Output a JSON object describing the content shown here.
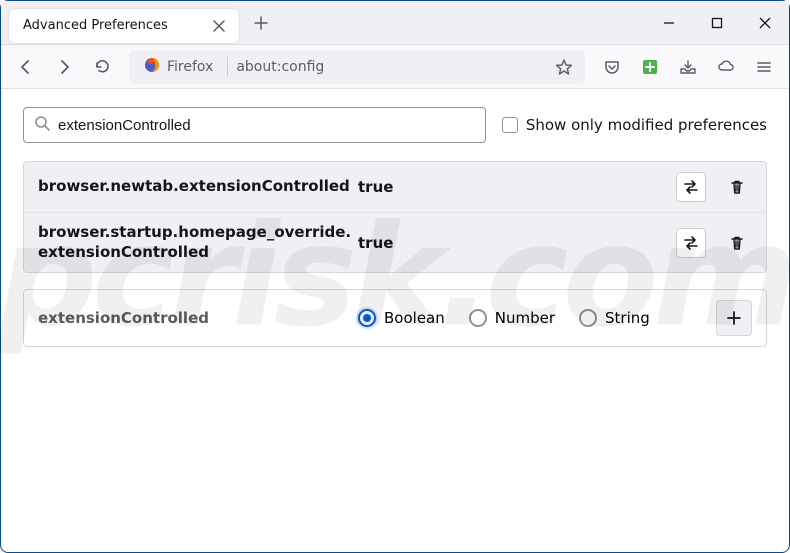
{
  "window": {
    "tab_title": "Advanced Preferences"
  },
  "urlbar": {
    "identity_label": "Firefox",
    "url": "about:config"
  },
  "search": {
    "value": "extensionControlled",
    "modified_only_label": "Show only modified preferences"
  },
  "prefs": [
    {
      "name": "browser.newtab.extensionControlled",
      "value": "true"
    },
    {
      "name": "browser.startup.homepage_override.extensionControlled",
      "value": "true"
    }
  ],
  "new_pref": {
    "name": "extensionControlled",
    "types": [
      "Boolean",
      "Number",
      "String"
    ],
    "selected": "Boolean"
  },
  "watermark": "pcrisk.com"
}
